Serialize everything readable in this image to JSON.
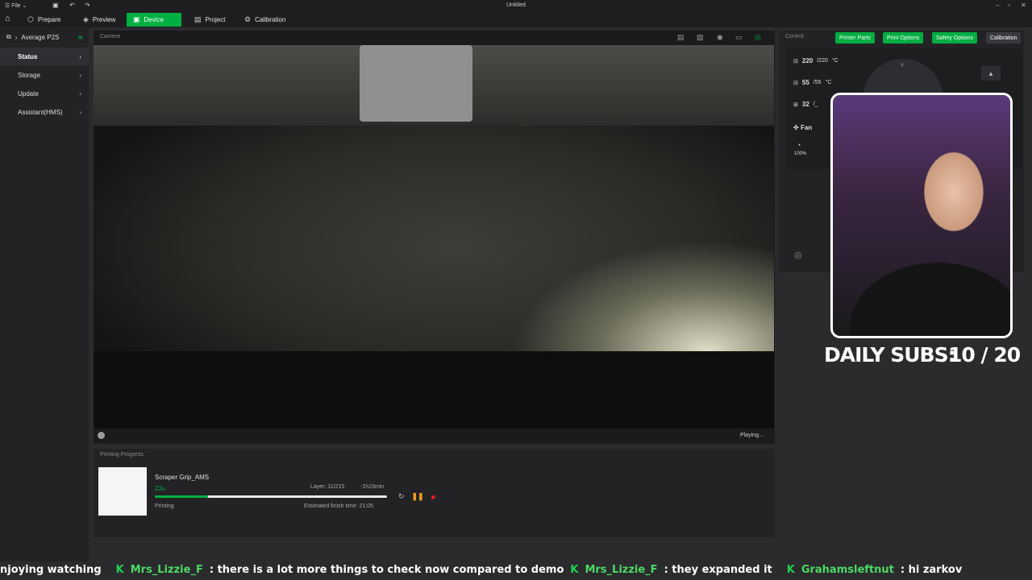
{
  "window": {
    "file_menu": "File",
    "title": "Untitled"
  },
  "tabs": [
    {
      "label": "Prepare",
      "icon": "cube-icon"
    },
    {
      "label": "Preview",
      "icon": "layers-icon"
    },
    {
      "label": "Device",
      "icon": "printer-icon",
      "active": true
    },
    {
      "label": "Project",
      "icon": "project-icon"
    },
    {
      "label": "Calibration",
      "icon": "calibration-icon"
    }
  ],
  "sidebar": {
    "printer_name": "Average P2S",
    "items": [
      {
        "label": "Status",
        "active": true
      },
      {
        "label": "Storage"
      },
      {
        "label": "Update"
      },
      {
        "label": "Assistant(HMS)"
      }
    ]
  },
  "camera": {
    "title": "Camera",
    "status": "Playing..."
  },
  "progress": {
    "title": "Printing Progress",
    "job_name": "Scraper Grip_AMS",
    "percent_value": 23,
    "percent_label": "23",
    "percent_unit": "%",
    "layer": "Layer: 11/215",
    "remaining": "-1h15min",
    "status": "Printing",
    "eta": "Estimated finish time: 21:05"
  },
  "control": {
    "title": "Control",
    "tabs": [
      "Printer Parts",
      "Print Options",
      "Safety Options",
      "Calibration"
    ],
    "nozzle": {
      "current": "220",
      "target": "/220",
      "unit": "°C"
    },
    "bed": {
      "current": "55",
      "target": "/55",
      "unit": "°C"
    },
    "chamber": {
      "current": "32",
      "target": "/_"
    },
    "fan_label": "Fan",
    "fan_percent": "100%",
    "jog_label": "Y"
  },
  "overlay": {
    "subs_label": "DAILY SUBS:",
    "subs_value": "10 / 20"
  },
  "ticker": {
    "lead": "njoying watching",
    "user1": "Mrs_Lizzie_F",
    "msg1": ": there is a lot more things to check now compared to demo",
    "user2": "Mrs_Lizzie_F",
    "msg2": ": they expanded it",
    "user3": "Grahamsleftnut",
    "msg3": ": hi zarkov"
  },
  "colors": {
    "accent": "#00ae42",
    "background": "#2b2b2e",
    "panel": "#232326"
  }
}
